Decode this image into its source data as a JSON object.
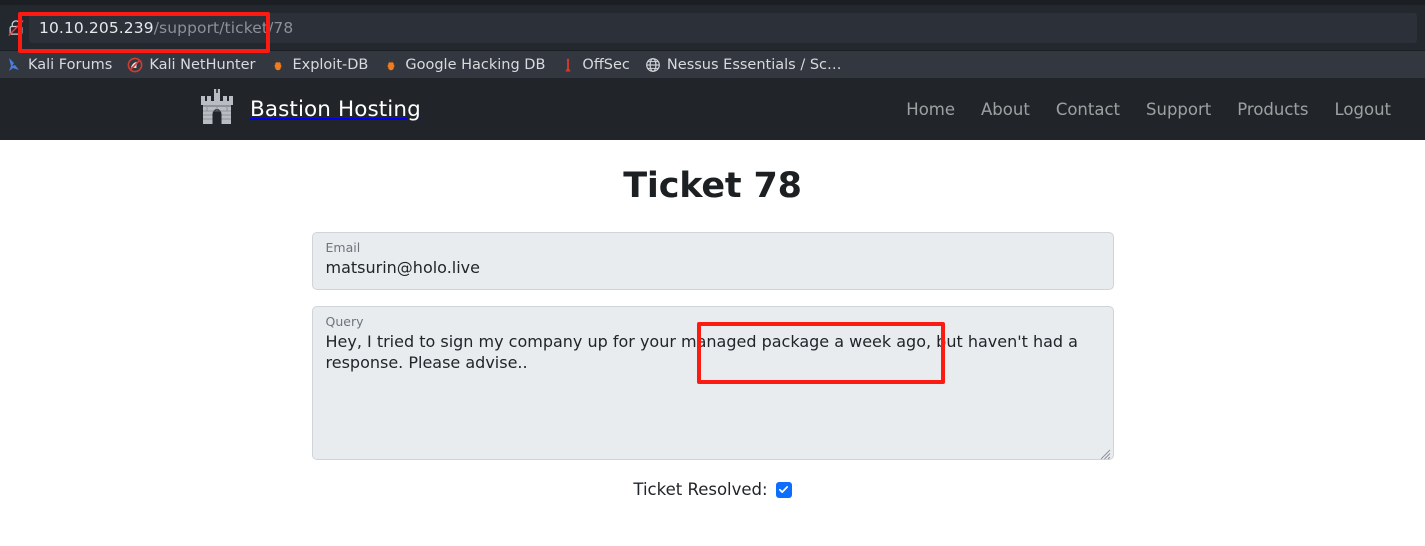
{
  "browser": {
    "security_icon": "lock-crossed-out-icon",
    "url": {
      "host": "10.10.205.239",
      "path": "/support/ticket/78",
      "full": "10.10.205.239/support/ticket/78"
    },
    "bookmarks": [
      {
        "label": "Kali Forums",
        "icon": "kali-dragon-icon"
      },
      {
        "label": "Kali NetHunter",
        "icon": "nethunter-icon"
      },
      {
        "label": "Exploit-DB",
        "icon": "exploit-db-icon"
      },
      {
        "label": "Google Hacking DB",
        "icon": "exploit-db-icon"
      },
      {
        "label": "OffSec",
        "icon": "offsec-icon"
      },
      {
        "label": "Nessus Essentials / Sc…",
        "icon": "globe-icon"
      }
    ]
  },
  "site": {
    "brand": {
      "name": "Bastion Hosting",
      "icon": "castle-icon"
    },
    "nav_links": [
      {
        "label": "Home"
      },
      {
        "label": "About"
      },
      {
        "label": "Contact"
      },
      {
        "label": "Support"
      },
      {
        "label": "Products"
      },
      {
        "label": "Logout"
      }
    ]
  },
  "page": {
    "title": "Ticket 78",
    "email": {
      "label": "Email",
      "value": "matsurin@holo.live"
    },
    "query": {
      "label": "Query",
      "value": "Hey, I tried to sign my company up for your managed package a week ago, but haven't had a response. Please advise.."
    },
    "resolved": {
      "label": "Ticket Resolved:",
      "checked": true
    }
  },
  "annotations": {
    "color": "#fb1b13",
    "boxes": [
      {
        "target": "url-field"
      },
      {
        "target": "page-title"
      }
    ]
  }
}
